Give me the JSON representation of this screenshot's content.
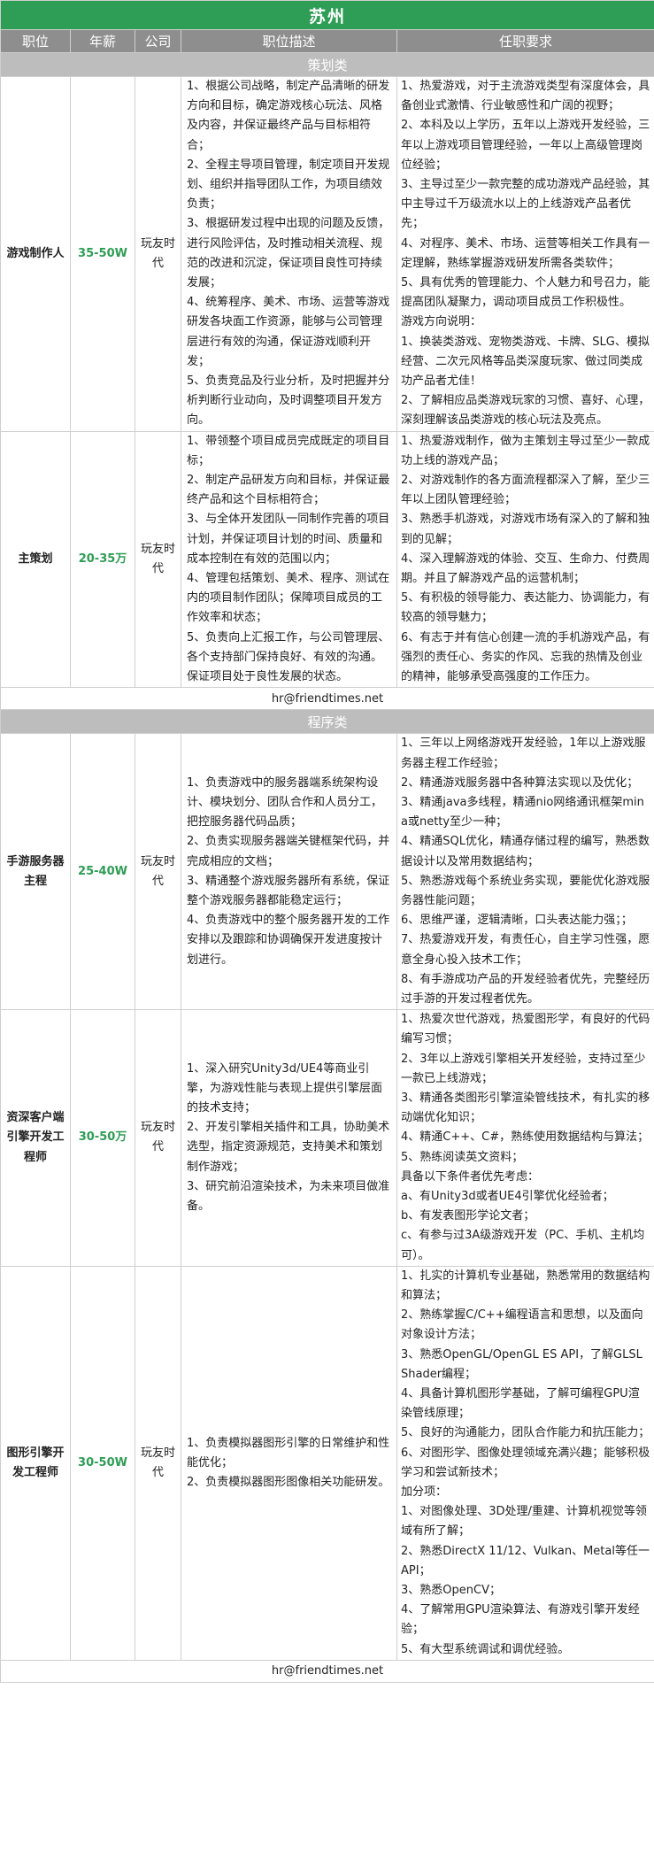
{
  "page": {
    "city": "苏州",
    "headers": [
      "职位",
      "年薪",
      "公司",
      "职位描述",
      "任职要求"
    ],
    "colors": {
      "title_bg": "#2e9d55",
      "header_bg": "#8e8e8e",
      "category_bg": "#bdbdbd",
      "salary_text": "#2e9d55"
    }
  },
  "sections": [
    {
      "category": "策划类",
      "email": "hr@friendtimes.net",
      "jobs": [
        {
          "title": "游戏制作人",
          "salary": "35-50W",
          "company": "玩友时代",
          "description": [
            "1、根据公司战略，制定产品清晰的研发方向和目标，确定游戏核心玩法、风格及内容，并保证最终产品与目标相符合；",
            "2、全程主导项目管理，制定项目开发规划、组织并指导团队工作，为项目绩效负责；",
            "3、根据研发过程中出现的问题及反馈，进行风险评估，及时推动相关流程、规范的改进和沉淀，保证项目良性可持续发展；",
            "4、统筹程序、美术、市场、运营等游戏研发各块面工作资源，能够与公司管理层进行有效的沟通，保证游戏顺利开发；",
            "5、负责竞品及行业分析，及时把握并分析判断行业动向，及时调整项目开发方向。"
          ],
          "requirements": [
            "1、热爱游戏，对于主流游戏类型有深度体会，具备创业式激情、行业敏感性和广阔的视野；",
            "2、本科及以上学历，五年以上游戏开发经验，三年以上游戏项目管理经验，一年以上高级管理岗位经验；",
            "3、主导过至少一款完整的成功游戏产品经验，其中主导过千万级流水以上的上线游戏产品者优先；",
            "4、对程序、美术、市场、运营等相关工作具有一定理解，熟练掌握游戏研发所需各类软件；",
            "5、具有优秀的管理能力、个人魅力和号召力，能提高团队凝聚力，调动项目成员工作积极性。",
            "游戏方向说明：",
            "1、换装类游戏、宠物类游戏、卡牌、SLG、模拟经营、二次元风格等品类深度玩家、做过同类成功产品者尤佳！",
            "2、了解相应品类游戏玩家的习惯、喜好、心理，深刻理解该品类游戏的核心玩法及亮点。"
          ]
        },
        {
          "title": "主策划",
          "salary": "20-35万",
          "company": "玩友时代",
          "description": [
            "1、带领整个项目成员完成既定的项目目标；",
            "2、制定产品研发方向和目标，并保证最终产品和这个目标相符合；",
            "3、与全体开发团队一同制作完善的项目计划，并保证项目计划的时间、质量和成本控制在有效的范围以内；",
            "4、管理包括策划、美术、程序、测试在内的项目制作团队；保障项目成员的工作效率和状态；",
            "5、负责向上汇报工作，与公司管理层、各个支持部门保持良好、有效的沟通。保证项目处于良性发展的状态。"
          ],
          "requirements": [
            "1、热爱游戏制作，做为主策划主导过至少一款成功上线的游戏产品；",
            "2、对游戏制作的各方面流程都深入了解，至少三年以上团队管理经验；",
            "3、熟悉手机游戏，对游戏市场有深入的了解和独到的见解；",
            "4、深入理解游戏的体验、交互、生命力、付费周期。并且了解游戏产品的运营机制；",
            "5、有积极的领导能力、表达能力、协调能力，有较高的领导魅力；",
            "6、有志于并有信心创建一流的手机游戏产品，有强烈的责任心、务实的作风、忘我的热情及创业的精神，能够承受高强度的工作压力。"
          ]
        }
      ]
    },
    {
      "category": "程序类",
      "email": "hr@friendtimes.net",
      "jobs": [
        {
          "title": "手游服务器主程",
          "salary": "25-40W",
          "company": "玩友时代",
          "description": [
            "1、负责游戏中的服务器端系统架构设计、模块划分、团队合作和人员分工，把控服务器代码品质；",
            "2、负责实现服务器端关键框架代码，并完成相应的文档；",
            "3、精通整个游戏服务器所有系统，保证整个游戏服务器都能稳定运行；",
            "4、负责游戏中的整个服务器开发的工作安排以及跟踪和协调确保开发进度按计划进行。"
          ],
          "requirements": [
            "1、三年以上网络游戏开发经验，1年以上游戏服务器主程工作经验；",
            "2、精通游戏服务器中各种算法实现以及优化；",
            "3、精通java多线程，精通nio网络通讯框架mina或netty至少一种；",
            "4、精通SQL优化，精通存储过程的编写，熟悉数据设计以及常用数据结构；",
            "5、熟悉游戏每个系统业务实现，要能优化游戏服务器性能问题；",
            "6、思维严谨，逻辑清晰，口头表达能力强；；",
            "7、热爱游戏开发，有责任心，自主学习性强，愿意全身心投入技术工作；",
            "8、有手游成功产品的开发经验者优先，完整经历过手游的开发过程者优先。"
          ]
        },
        {
          "title": "资深客户端引擎开发工程师",
          "salary": "30-50万",
          "company": "玩友时代",
          "description": [
            "1、深入研究Unity3d/UE4等商业引擎，为游戏性能与表现上提供引擎层面的技术支持；",
            "2、开发引擎相关插件和工具，协助美术选型，指定资源规范，支持美术和策划制作游戏；",
            "3、研究前沿渲染技术，为未来项目做准备。"
          ],
          "requirements": [
            "1、热爱次世代游戏，热爱图形学，有良好的代码编写习惯；",
            "2、3年以上游戏引擎相关开发经验，支持过至少一款已上线游戏；",
            "3、精通各类图形引擎渲染管线技术，有扎实的移动端优化知识；",
            "4、精通C++、C#，熟练使用数据结构与算法；",
            "5、熟练阅读英文资料；",
            "具备以下条件者优先考虑：",
            "a、有Unity3d或者UE4引擎优化经验者；",
            "b、有发表图形学论文者；",
            "c、有参与过3A级游戏开发（PC、手机、主机均可）。"
          ]
        },
        {
          "title": "图形引擎开发工程师",
          "salary": "30-50W",
          "company": "玩友时代",
          "description": [
            "1、负责模拟器图形引擎的日常维护和性能优化；",
            "2、负责模拟器图形图像相关功能研发。"
          ],
          "requirements": [
            "1、扎实的计算机专业基础，熟悉常用的数据结构和算法；",
            "2、熟练掌握C/C++编程语言和思想，以及面向对象设计方法；",
            "3、熟悉OpenGL/OpenGL ES API，了解GLSL Shader编程；",
            "4、具备计算机图形学基础，了解可编程GPU渲染管线原理；",
            "5、良好的沟通能力，团队合作能力和抗压能力；",
            "6、对图形学、图像处理领域充满兴趣；能够积极学习和尝试新技术；",
            "加分项：",
            "1、对图像处理、3D处理/重建、计算机视觉等领域有所了解；",
            "2、熟悉DirectX 11/12、Vulkan、Metal等任一API；",
            "3、熟悉OpenCV；",
            "4、了解常用GPU渲染算法、有游戏引擎开发经验；",
            "5、有大型系统调试和调优经验。"
          ]
        }
      ]
    }
  ]
}
